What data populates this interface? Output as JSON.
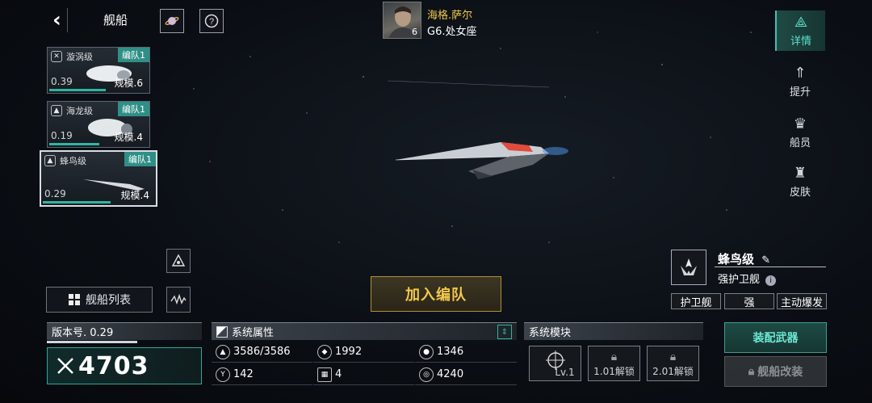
{
  "header": {
    "title": "舰船",
    "captain_name": "海格.萨尔",
    "captain_level": "6",
    "captain_sub": "G6.处女座"
  },
  "ship_cards": [
    {
      "name": "漩涡级",
      "tag": "编队1",
      "value": "0.39",
      "scale": "规模.6"
    },
    {
      "name": "海龙级",
      "tag": "编队1",
      "value": "0.19",
      "scale": "规模.4"
    },
    {
      "name": "蜂鸟级",
      "tag": "编队1",
      "value": "0.29",
      "scale": "规模.4"
    }
  ],
  "right_nav": [
    {
      "label": "详情",
      "icon": "details-icon"
    },
    {
      "label": "提升",
      "icon": "upgrade-icon"
    },
    {
      "label": "船员",
      "icon": "crew-icon"
    },
    {
      "label": "皮肤",
      "icon": "skin-icon"
    }
  ],
  "buttons": {
    "ship_list": "舰船列表",
    "join_fleet": "加入编队",
    "equip_weapon": "装配武器",
    "ship_modify": "舰船改装"
  },
  "ship_info": {
    "name": "蜂鸟级",
    "class": "强护卫舰",
    "tags": [
      "护卫舰",
      "强",
      "主动爆发"
    ]
  },
  "version": {
    "label": "版本号. 0.29",
    "power": "4703"
  },
  "attributes": {
    "title": "系统属性",
    "stats": [
      {
        "icon": "hull-icon",
        "value": "3586/3586"
      },
      {
        "icon": "armor-icon",
        "value": "1992"
      },
      {
        "icon": "shield-icon",
        "value": "1346"
      },
      {
        "icon": "speed-icon",
        "value": "142"
      },
      {
        "icon": "grid-icon",
        "value": "4"
      },
      {
        "icon": "target-icon",
        "value": "4240"
      }
    ]
  },
  "modules": {
    "title": "系统模块",
    "items": [
      {
        "label": "Lv.1",
        "locked": false
      },
      {
        "label": "1.01解锁",
        "locked": true
      },
      {
        "label": "2.01解锁",
        "locked": true
      }
    ]
  },
  "colors": {
    "accent_teal": "#41c2b0",
    "accent_gold": "#f2c94c",
    "captain_name": "#f1c94a"
  }
}
